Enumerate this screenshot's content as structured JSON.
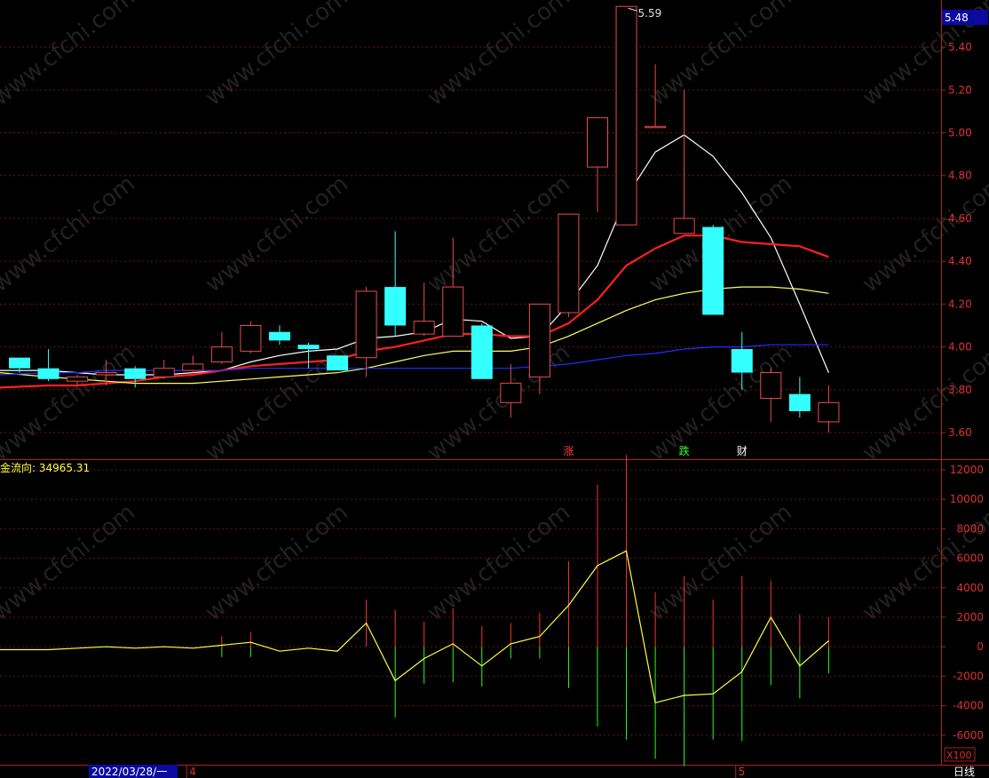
{
  "colors": {
    "up": "#e84c4c",
    "down": "#33ffff",
    "ma5": "#ffffff",
    "ma10": "#ff2020",
    "ma20": "#ffff66",
    "ma60": "#2030ff",
    "grid": "#6a1414",
    "border": "#b02020",
    "mf_line": "#ffff40",
    "mf_pos": "#ff3030",
    "mf_neg": "#22ff22"
  },
  "price_axis": {
    "ticks": [
      "5.40",
      "5.20",
      "5.00",
      "4.80",
      "4.60",
      "4.40",
      "4.20",
      "4.00",
      "3.80",
      "3.60"
    ],
    "current_price": "5.48",
    "max_label": "5.59"
  },
  "markers": [
    {
      "text": "涨",
      "color": "#ff4040",
      "index": 19
    },
    {
      "text": "跌",
      "color": "#33ff33",
      "index": 23
    },
    {
      "text": "财",
      "color": "#ffffff",
      "index": 25
    }
  ],
  "moneyflow": {
    "label": "金流向: 34965.31",
    "ticks": [
      "12000",
      "10000",
      "8000",
      "6000",
      "4000",
      "2000",
      "0",
      "-2000",
      "-4000",
      "-6000"
    ],
    "scale": "X100"
  },
  "time_axis": {
    "date_label": "2022/03/28/一",
    "month_labels": [
      {
        "text": "4",
        "index": 6
      },
      {
        "text": "5",
        "index": 25
      }
    ],
    "period_label": "日线"
  },
  "watermark": "www.cfchi.com",
  "chart_data": [
    {
      "type": "candlestick",
      "title": "",
      "candles": [
        {
          "o": 3.95,
          "h": 3.95,
          "l": 3.88,
          "c": 3.9
        },
        {
          "o": 3.9,
          "h": 3.99,
          "l": 3.84,
          "c": 3.85
        },
        {
          "o": 3.84,
          "h": 3.87,
          "l": 3.82,
          "c": 3.86
        },
        {
          "o": 3.87,
          "h": 3.94,
          "l": 3.82,
          "c": 3.88
        },
        {
          "o": 3.9,
          "h": 3.91,
          "l": 3.81,
          "c": 3.85
        },
        {
          "o": 3.86,
          "h": 3.94,
          "l": 3.85,
          "c": 3.9
        },
        {
          "o": 3.89,
          "h": 3.96,
          "l": 3.88,
          "c": 3.92
        },
        {
          "o": 3.93,
          "h": 4.07,
          "l": 3.92,
          "c": 4.0
        },
        {
          "o": 3.98,
          "h": 4.12,
          "l": 3.97,
          "c": 4.1
        },
        {
          "o": 4.07,
          "h": 4.1,
          "l": 4.01,
          "c": 4.03
        },
        {
          "o": 4.01,
          "h": 4.02,
          "l": 3.9,
          "c": 3.99
        },
        {
          "o": 3.96,
          "h": 3.96,
          "l": 3.89,
          "c": 3.89
        },
        {
          "o": 3.95,
          "h": 4.28,
          "l": 3.86,
          "c": 4.26
        },
        {
          "o": 4.28,
          "h": 4.54,
          "l": 4.05,
          "c": 4.1
        },
        {
          "o": 4.06,
          "h": 4.3,
          "l": 4.05,
          "c": 4.12
        },
        {
          "o": 4.05,
          "h": 4.51,
          "l": 4.05,
          "c": 4.28
        },
        {
          "o": 4.1,
          "h": 4.11,
          "l": 3.87,
          "c": 3.85
        },
        {
          "o": 3.74,
          "h": 3.92,
          "l": 3.67,
          "c": 3.83
        },
        {
          "o": 3.86,
          "h": 4.19,
          "l": 3.78,
          "c": 4.2
        },
        {
          "o": 4.16,
          "h": 4.62,
          "l": 4.14,
          "c": 4.62
        },
        {
          "o": 4.84,
          "h": 5.07,
          "l": 4.63,
          "c": 5.07
        },
        {
          "o": 4.57,
          "h": 5.59,
          "l": 4.57,
          "c": 5.59
        },
        {
          "o": 5.03,
          "h": 5.32,
          "l": 5.03,
          "c": 5.03
        },
        {
          "o": 4.53,
          "h": 5.2,
          "l": 4.53,
          "c": 4.6
        },
        {
          "o": 4.56,
          "h": 4.57,
          "l": 4.15,
          "c": 4.15
        },
        {
          "o": 3.99,
          "h": 4.07,
          "l": 3.8,
          "c": 3.88
        },
        {
          "o": 3.76,
          "h": 3.9,
          "l": 3.65,
          "c": 3.88
        },
        {
          "o": 3.78,
          "h": 3.86,
          "l": 3.67,
          "c": 3.7
        },
        {
          "o": 3.65,
          "h": 3.82,
          "l": 3.6,
          "c": 3.74
        }
      ],
      "ma": [
        {
          "name": "MA5",
          "values": [
            3.89,
            3.89,
            3.88,
            3.87,
            3.87,
            3.87,
            3.88,
            3.89,
            3.93,
            3.96,
            3.98,
            3.99,
            4.04,
            4.05,
            4.07,
            4.13,
            4.12,
            4.04,
            4.05,
            4.2,
            4.38,
            4.7,
            4.91,
            4.99,
            4.89,
            4.72,
            4.51,
            4.2,
            3.88
          ]
        },
        {
          "name": "MA10",
          "values": [
            3.81,
            3.82,
            3.82,
            3.83,
            3.84,
            3.86,
            3.87,
            3.89,
            3.91,
            3.92,
            3.93,
            3.94,
            3.98,
            4.0,
            4.03,
            4.06,
            4.06,
            4.05,
            4.05,
            4.11,
            4.22,
            4.38,
            4.46,
            4.52,
            4.52,
            4.49,
            4.48,
            4.47,
            4.42
          ]
        },
        {
          "name": "MA20",
          "values": [
            3.88,
            3.86,
            3.85,
            3.84,
            3.83,
            3.83,
            3.83,
            3.84,
            3.85,
            3.86,
            3.87,
            3.88,
            3.9,
            3.93,
            3.96,
            3.98,
            3.98,
            3.98,
            4.0,
            4.05,
            4.11,
            4.17,
            4.22,
            4.25,
            4.27,
            4.28,
            4.28,
            4.27,
            4.25
          ]
        },
        {
          "name": "MA60",
          "values": [
            3.87,
            3.88,
            3.88,
            3.89,
            3.89,
            3.89,
            3.89,
            3.89,
            3.9,
            3.9,
            3.9,
            3.9,
            3.9,
            3.9,
            3.9,
            3.9,
            3.9,
            3.9,
            3.91,
            3.92,
            3.94,
            3.96,
            3.97,
            3.99,
            4.0,
            4.0,
            4.01,
            4.01,
            4.01
          ]
        }
      ],
      "ylim": [
        3.48,
        5.62
      ]
    },
    {
      "type": "bar",
      "title": "",
      "positive": [
        0,
        0,
        0,
        0,
        0,
        0,
        0,
        700,
        1000,
        0,
        0,
        0,
        3200,
        2500,
        1700,
        2600,
        1400,
        1600,
        2300,
        5800,
        11000,
        13000,
        3700,
        4800,
        3200,
        4800,
        4500,
        2200,
        2000
      ],
      "negative": [
        0,
        0,
        0,
        0,
        0,
        0,
        0,
        -700,
        -700,
        0,
        0,
        0,
        0,
        -4800,
        -2500,
        -2400,
        -2700,
        -800,
        -800,
        -2800,
        -5400,
        -6300,
        -7600,
        -8100,
        -6300,
        -6400,
        -2600,
        -3500,
        -1800
      ],
      "line": [
        -200,
        -200,
        -100,
        0,
        -100,
        0,
        -100,
        100,
        300,
        -300,
        -100,
        -300,
        1600,
        -2300,
        -800,
        200,
        -1300,
        200,
        700,
        2800,
        5500,
        6500,
        -3800,
        -3300,
        -3200,
        -1700,
        2000,
        -1300,
        400
      ],
      "ylim": [
        -8000,
        12600
      ]
    }
  ]
}
